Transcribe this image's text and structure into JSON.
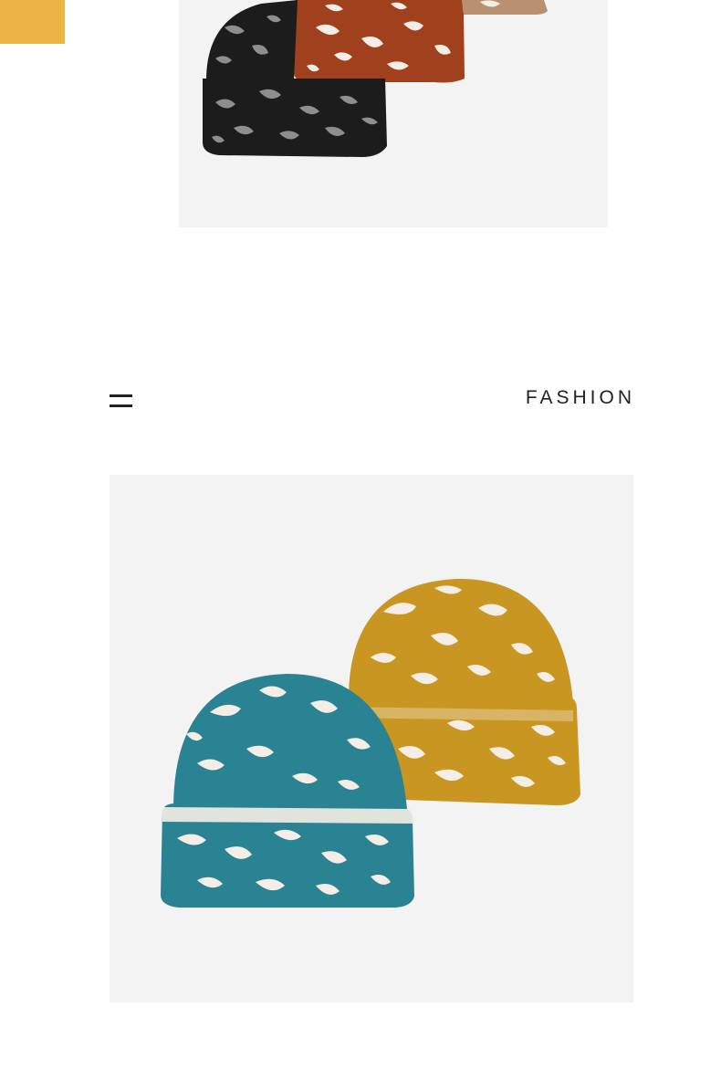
{
  "section": {
    "title": "FASHION"
  },
  "colors": {
    "accent": "#EBB444",
    "photo_bg": "#F3F3F3",
    "hat_black": "#1C1C1C",
    "hat_rust": "#A0401C",
    "hat_tan": "#B89270",
    "hat_teal": "#2A8393",
    "hat_mustard": "#C99621",
    "spot_cream": "#F4EEE6",
    "spot_grey": "#8E8E8E"
  },
  "images": {
    "top": {
      "subject": "leopard-knit-beanie-stack-icon"
    },
    "main": {
      "subject": "teal-and-mustard-leopard-beanies-icon"
    }
  }
}
